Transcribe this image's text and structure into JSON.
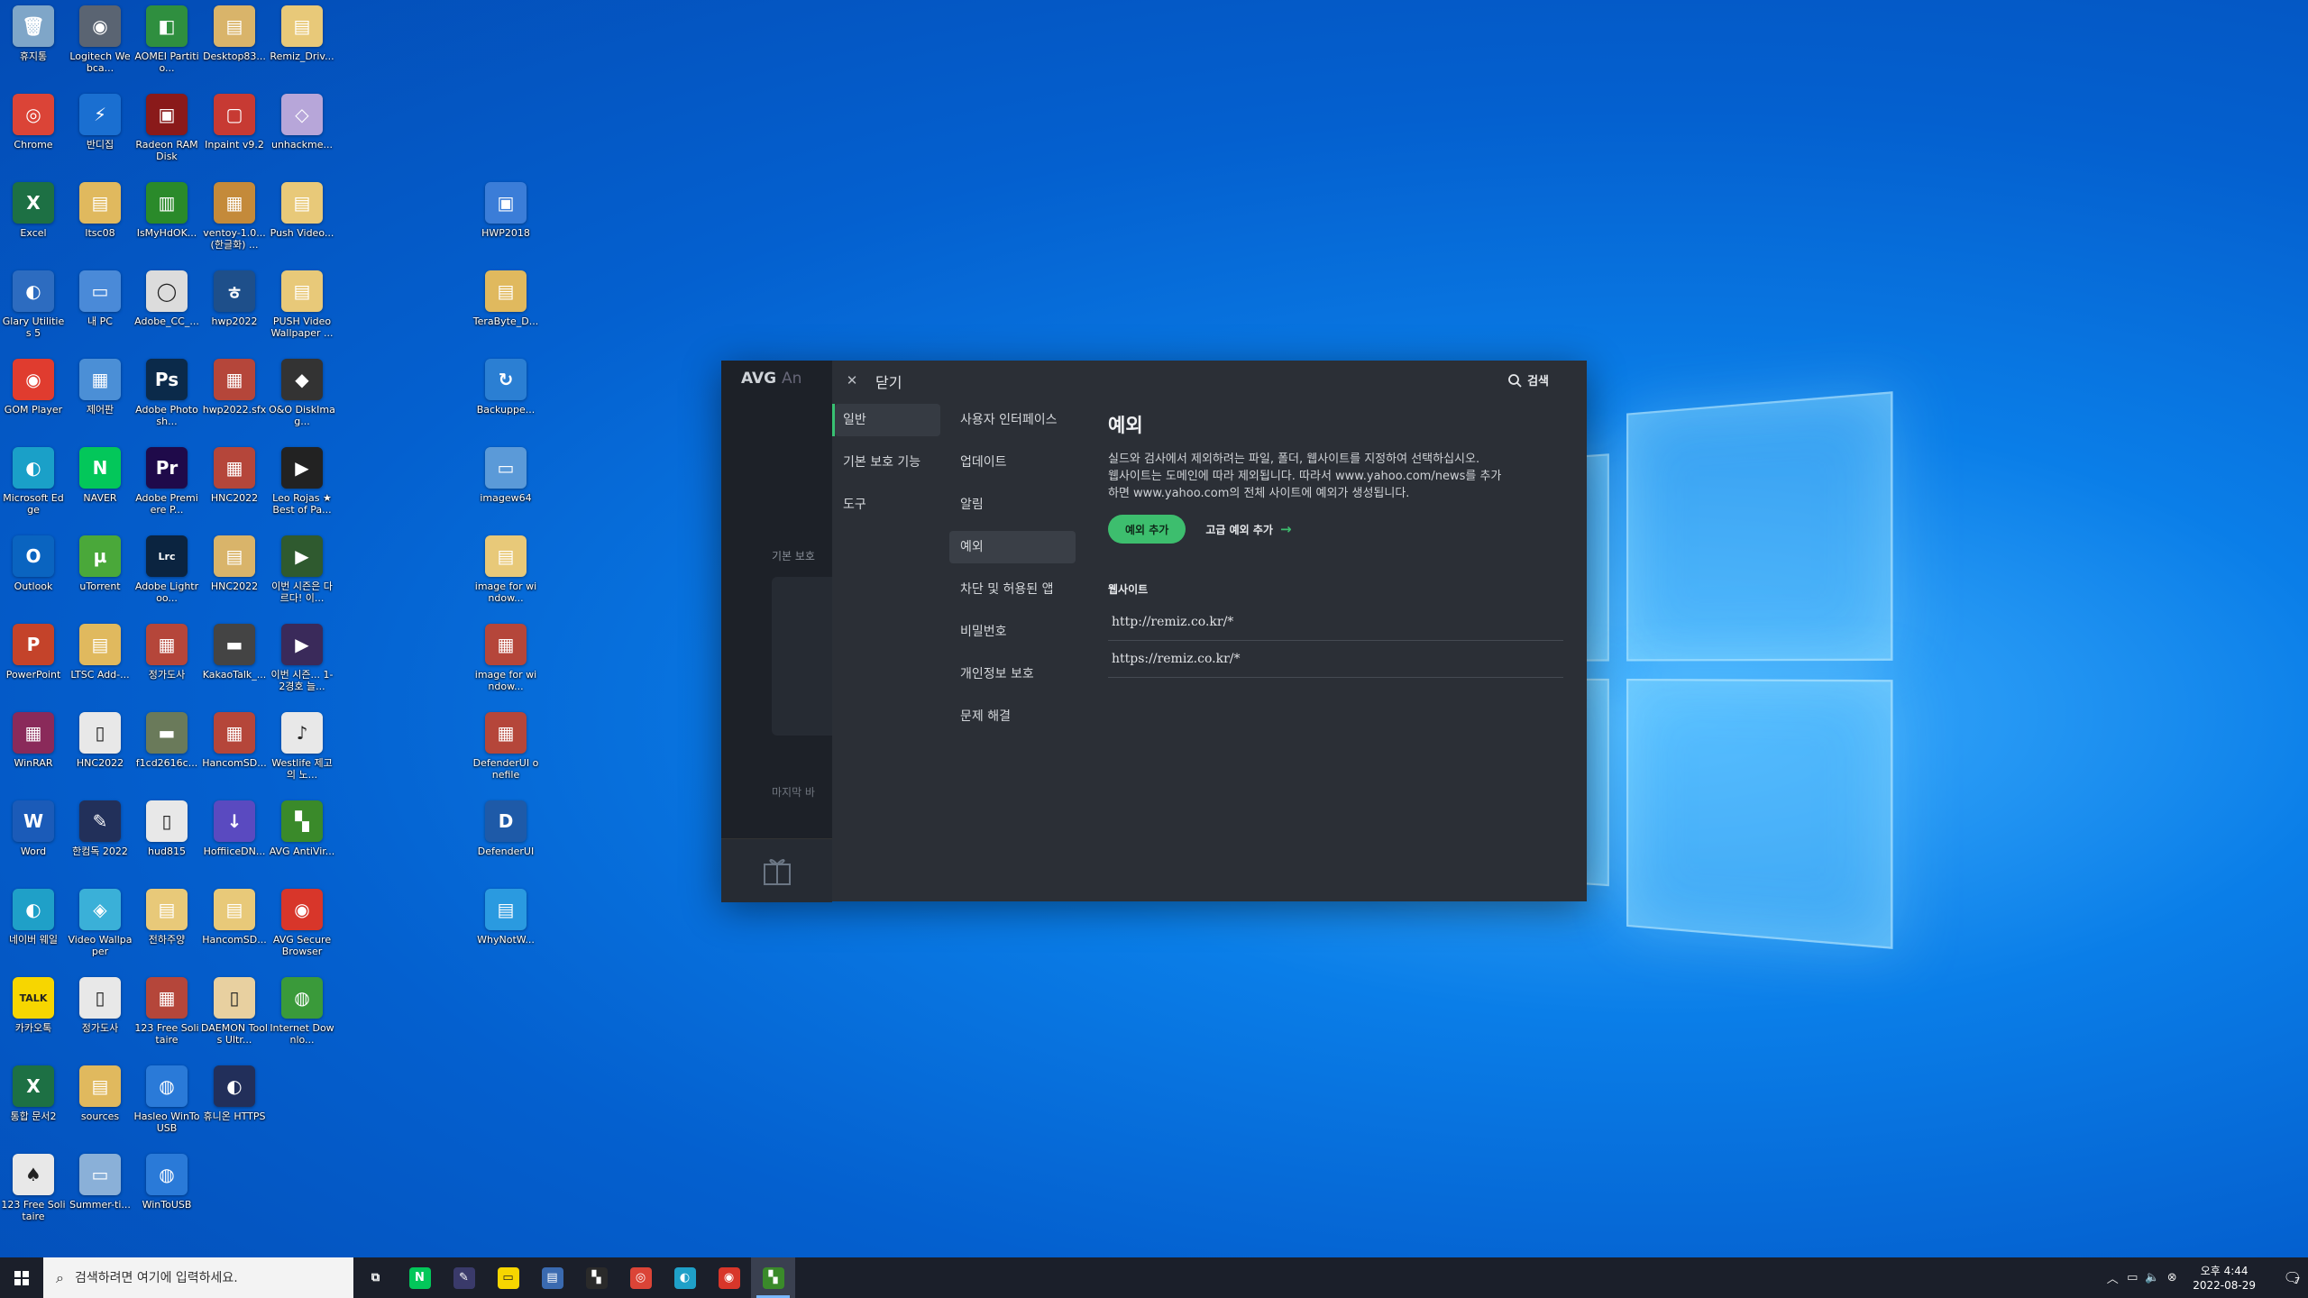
{
  "desktop": {
    "icons": [
      {
        "label": "휴지통",
        "glyph": "🗑",
        "color": "#7fa6c8"
      },
      {
        "label": "Logitech Webca...",
        "glyph": "◉",
        "color": "#5a6472"
      },
      {
        "label": "AOMEI Partitio...",
        "glyph": "◧",
        "color": "#2f8f3f"
      },
      {
        "label": "Desktop83...",
        "glyph": "▤",
        "color": "#d9b46a"
      },
      {
        "label": "Remiz_Driv...",
        "glyph": "▤",
        "color": "#e8c979"
      },
      {
        "label": "Chrome",
        "glyph": "◎",
        "color": "#db4437"
      },
      {
        "label": "반디집",
        "glyph": "⚡",
        "color": "#1a6fd1"
      },
      {
        "label": "Radeon RAMDisk",
        "glyph": "▣",
        "color": "#8a1a1a"
      },
      {
        "label": "Inpaint v9.2",
        "glyph": "▢",
        "color": "#c73a33"
      },
      {
        "label": "unhackme...",
        "glyph": "◇",
        "color": "#b7a6d9"
      },
      {
        "label": "Excel",
        "glyph": "X",
        "color": "#1d7044"
      },
      {
        "label": "ltsc08",
        "glyph": "▤",
        "color": "#e0b95e"
      },
      {
        "label": "IsMyHdOK...",
        "glyph": "▥",
        "color": "#2a8a2a"
      },
      {
        "label": "ventoy-1.0... (한글화) ...",
        "glyph": "▦",
        "color": "#c48a3a"
      },
      {
        "label": "Push Video...",
        "glyph": "▤",
        "color": "#e8c979"
      },
      {
        "label": "HWP2018",
        "glyph": "▣",
        "color": "#3b7dd8"
      },
      {
        "label": "Glary Utilities 5",
        "glyph": "◐",
        "color": "#2d6cc0"
      },
      {
        "label": "내 PC",
        "glyph": "▭",
        "color": "#4a8ad8"
      },
      {
        "label": "Adobe_CC_...",
        "glyph": "◯",
        "color": "#dcdcdc"
      },
      {
        "label": "hwp2022",
        "glyph": "ㅎ",
        "color": "#1e4f8a"
      },
      {
        "label": "PUSH Video Wallpaper ...",
        "glyph": "▤",
        "color": "#e8c979"
      },
      {
        "label": "TeraByte_D...",
        "glyph": "▤",
        "color": "#e0b95e"
      },
      {
        "label": "GOM Player",
        "glyph": "◉",
        "color": "#e03c2f"
      },
      {
        "label": "제어판",
        "glyph": "▦",
        "color": "#4b8fd6"
      },
      {
        "label": "Adobe Photosh...",
        "glyph": "Ps",
        "color": "#0b2a4a"
      },
      {
        "label": "hwp2022.sfx",
        "glyph": "▦",
        "color": "#b5463a"
      },
      {
        "label": "O&O DiskImag...",
        "glyph": "◆",
        "color": "#333333"
      },
      {
        "label": "Backuppe...",
        "glyph": "↻",
        "color": "#2b7fd3"
      },
      {
        "label": "Microsoft Edge",
        "glyph": "◐",
        "color": "#1aa0c8"
      },
      {
        "label": "NAVER",
        "glyph": "N",
        "color": "#03c75a"
      },
      {
        "label": "Adobe Premiere P...",
        "glyph": "Pr",
        "color": "#1f0a4a"
      },
      {
        "label": "HNC2022",
        "glyph": "▦",
        "color": "#b5463a"
      },
      {
        "label": "Leo Rojas ★ Best of Pa...",
        "glyph": "▶",
        "color": "#222222"
      },
      {
        "label": "imagew64",
        "glyph": "▭",
        "color": "#5b9ad8"
      },
      {
        "label": "Outlook",
        "glyph": "O",
        "color": "#0a64c0"
      },
      {
        "label": "uTorrent",
        "glyph": "µ",
        "color": "#4aa83a"
      },
      {
        "label": "Adobe Lightroo...",
        "glyph": "Lrc",
        "color": "#0b2440"
      },
      {
        "label": "HNC2022",
        "glyph": "▤",
        "color": "#d9b46a"
      },
      {
        "label": "이번 시즌은 다르다! 이...",
        "glyph": "▶",
        "color": "#2f5a2f"
      },
      {
        "label": "image for window...",
        "glyph": "▤",
        "color": "#e8c979"
      },
      {
        "label": "PowerPoint",
        "glyph": "P",
        "color": "#c4432a"
      },
      {
        "label": "LTSC Add-...",
        "glyph": "▤",
        "color": "#e0b95e"
      },
      {
        "label": "정가도사",
        "glyph": "▦",
        "color": "#b5463a"
      },
      {
        "label": "KakaoTalk_...",
        "glyph": "▬",
        "color": "#444444"
      },
      {
        "label": "이번 시즌... 1-2경호 늘...",
        "glyph": "▶",
        "color": "#3a2a5a"
      },
      {
        "label": "image for window...",
        "glyph": "▦",
        "color": "#b5463a"
      },
      {
        "label": "WinRAR",
        "glyph": "▦",
        "color": "#8a2a5a"
      },
      {
        "label": "HNC2022",
        "glyph": "▯",
        "color": "#e8e8e8"
      },
      {
        "label": "f1cd2616c...",
        "glyph": "▬",
        "color": "#6a7a5a"
      },
      {
        "label": "HancomSD...",
        "glyph": "▦",
        "color": "#b5463a"
      },
      {
        "label": "Westlife 제고의 노...",
        "glyph": "♪",
        "color": "#e8e8e8"
      },
      {
        "label": "DefenderUI onefile",
        "glyph": "▦",
        "color": "#b5463a"
      },
      {
        "label": "Word",
        "glyph": "W",
        "color": "#1b5bb8"
      },
      {
        "label": "한컴독 2022",
        "glyph": "✎",
        "color": "#22305a"
      },
      {
        "label": "hud815",
        "glyph": "▯",
        "color": "#e8e8e8"
      },
      {
        "label": "HoffiiceDN...",
        "glyph": "↓",
        "color": "#5a4ac0"
      },
      {
        "label": "AVG AntiVir...",
        "glyph": "▚",
        "color": "#3a8a2a"
      },
      {
        "label": "DefenderUI",
        "glyph": "D",
        "color": "#1e5aa8"
      },
      {
        "label": "네이버 웨일",
        "glyph": "◐",
        "color": "#1fa0c8"
      },
      {
        "label": "Video Wallpaper",
        "glyph": "◈",
        "color": "#3ab0d8"
      },
      {
        "label": "전하주양",
        "glyph": "▤",
        "color": "#e8c979"
      },
      {
        "label": "HancomSD...",
        "glyph": "▤",
        "color": "#e8c979"
      },
      {
        "label": "AVG Secure Browser",
        "glyph": "◉",
        "color": "#d8362a"
      },
      {
        "label": "WhyNotW...",
        "glyph": "▤",
        "color": "#2a9ae0"
      },
      {
        "label": "카카오톡",
        "glyph": "TALK",
        "color": "#f7d600"
      },
      {
        "label": "정가도사",
        "glyph": "▯",
        "color": "#e8e8e8"
      },
      {
        "label": "123 Free Solitaire",
        "glyph": "▦",
        "color": "#b5463a"
      },
      {
        "label": "DAEMON Tools Ultr...",
        "glyph": "▯",
        "color": "#e8d0a0"
      },
      {
        "label": "Internet Downlo...",
        "glyph": "◍",
        "color": "#3a9a3a"
      },
      {
        "label": "통합 문서2",
        "glyph": "X",
        "color": "#1d7044"
      },
      {
        "label": "sources",
        "glyph": "▤",
        "color": "#e0b95e"
      },
      {
        "label": "Hasleo WinToUSB",
        "glyph": "◍",
        "color": "#2a7ad8"
      },
      {
        "label": "휴니온 HTTPS",
        "glyph": "◐",
        "color": "#222f5a"
      },
      {
        "label": "123 Free Solitaire",
        "glyph": "♠",
        "color": "#e8e8e8"
      },
      {
        "label": "Summer-ti...",
        "glyph": "▭",
        "color": "#8ab0d8"
      },
      {
        "label": "WinToUSB",
        "glyph": "◍",
        "color": "#2a7ad8"
      }
    ]
  },
  "avg": {
    "brand": "AVG",
    "brand_suffix": "An",
    "bg_section_label": "기본 보호",
    "bg_last_label": "마지막 바",
    "close_label": "닫기",
    "search_label": "검색",
    "nav_primary": [
      "일반",
      "기본 보호 기능",
      "도구"
    ],
    "nav_secondary": [
      "사용자 인터페이스",
      "업데이트",
      "알림",
      "예외",
      "차단 및 허용된 앱",
      "비밀번호",
      "개인정보 보호",
      "문제 해결"
    ],
    "content": {
      "title": "예외",
      "desc_line1": "실드와 검사에서 제외하려는 파일, 폴더, 웹사이트를 지정하여 선택하십시오.",
      "desc_line2": "웹사이트는 도메인에 따라 제외됩니다. 따라서 www.yahoo.com/news를 추가",
      "desc_line3": "하면 www.yahoo.com의 전체 사이트에 예외가 생성됩니다.",
      "add_button": "예외 추가",
      "advanced_link": "고급 예외 추가",
      "section_title": "웹사이트",
      "urls": [
        "http://remiz.co.kr/*",
        "https://remiz.co.kr/*"
      ]
    }
  },
  "taskbar": {
    "search_placeholder": "검색하려면 여기에 입력하세요.",
    "apps": [
      {
        "name": "task-view",
        "glyph": "⧉",
        "color": "transparent"
      },
      {
        "name": "naver",
        "glyph": "N",
        "color": "#03c75a"
      },
      {
        "name": "hancom-pen",
        "glyph": "✎",
        "color": "#3a3a6a"
      },
      {
        "name": "kakaotalk",
        "glyph": "▭",
        "color": "#f7d600"
      },
      {
        "name": "explorer",
        "glyph": "▤",
        "color": "#3a6ab0"
      },
      {
        "name": "media",
        "glyph": "▚",
        "color": "#2a2a2a"
      },
      {
        "name": "chrome",
        "glyph": "◎",
        "color": "#db4437"
      },
      {
        "name": "whale",
        "glyph": "◐",
        "color": "#1fa0c8"
      },
      {
        "name": "avg-browser",
        "glyph": "◉",
        "color": "#d8362a"
      },
      {
        "name": "avg-antivirus",
        "glyph": "▚",
        "color": "#3a8a2a"
      }
    ],
    "time": "오후 4:44",
    "date": "2022-08-29",
    "notification_count": "7"
  }
}
